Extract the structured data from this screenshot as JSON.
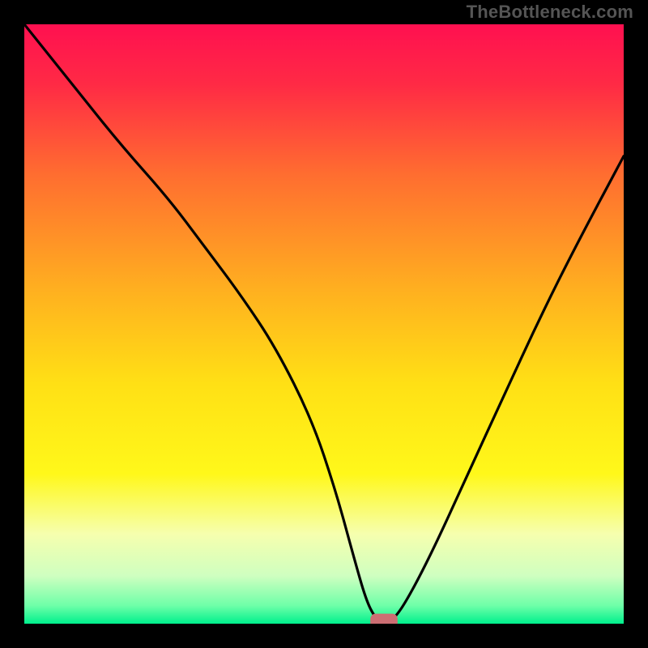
{
  "watermark": "TheBottleneck.com",
  "colors": {
    "gradient_stops": [
      {
        "offset": 0.0,
        "color": "#ff1050"
      },
      {
        "offset": 0.1,
        "color": "#ff2a45"
      },
      {
        "offset": 0.25,
        "color": "#ff6d30"
      },
      {
        "offset": 0.45,
        "color": "#ffb21f"
      },
      {
        "offset": 0.6,
        "color": "#ffe015"
      },
      {
        "offset": 0.75,
        "color": "#fff81a"
      },
      {
        "offset": 0.85,
        "color": "#f6ffae"
      },
      {
        "offset": 0.92,
        "color": "#cfffc0"
      },
      {
        "offset": 0.97,
        "color": "#6effa8"
      },
      {
        "offset": 1.0,
        "color": "#00f08d"
      }
    ],
    "curve": "#000000",
    "marker_fill": "#cc6e73",
    "marker_stroke": "#cc6e73",
    "background": "#000000"
  },
  "chart_data": {
    "type": "line",
    "title": "",
    "xlabel": "",
    "ylabel": "",
    "xlim": [
      0,
      100
    ],
    "ylim": [
      0,
      100
    ],
    "grid": false,
    "legend": false,
    "series": [
      {
        "name": "bottleneck-curve",
        "x": [
          0,
          8,
          16,
          24,
          30,
          36,
          42,
          48,
          52,
          55,
          57,
          58.5,
          60,
          62,
          65,
          69,
          74,
          80,
          86,
          92,
          100
        ],
        "y": [
          100,
          90,
          80,
          71,
          63,
          55,
          46,
          34,
          22,
          11,
          4,
          1,
          0,
          1,
          6,
          14,
          25,
          38,
          51,
          63,
          78
        ]
      }
    ],
    "marker": {
      "x": 60,
      "y": 0,
      "rx": 2.2,
      "ry": 1.2
    },
    "notes": "V-shaped curve with minimum ~x=60; left branch steeper than right. Background vertical gradient red→orange→yellow→pale→green. No axis ticks or labels."
  }
}
